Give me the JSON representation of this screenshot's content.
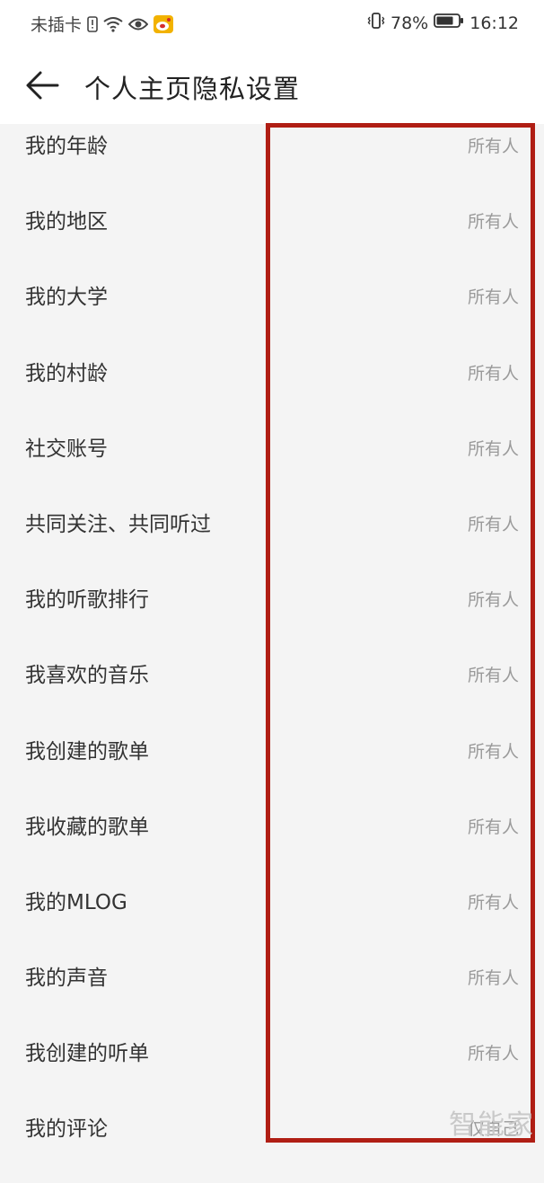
{
  "status_bar": {
    "carrier": "未插卡",
    "battery_percent": "78%",
    "time": "16:12",
    "icons": [
      "sim-alert-icon",
      "wifi-icon",
      "eye-icon",
      "weibo-icon",
      "vibrate-icon",
      "battery-icon"
    ]
  },
  "header": {
    "title": "个人主页隐私设置"
  },
  "settings": [
    {
      "label": "我的年龄",
      "value": "所有人"
    },
    {
      "label": "我的地区",
      "value": "所有人"
    },
    {
      "label": "我的大学",
      "value": "所有人"
    },
    {
      "label": "我的村龄",
      "value": "所有人"
    },
    {
      "label": "社交账号",
      "value": "所有人"
    },
    {
      "label": "共同关注、共同听过",
      "value": "所有人"
    },
    {
      "label": "我的听歌排行",
      "value": "所有人"
    },
    {
      "label": "我喜欢的音乐",
      "value": "所有人"
    },
    {
      "label": "我创建的歌单",
      "value": "所有人"
    },
    {
      "label": "我收藏的歌单",
      "value": "所有人"
    },
    {
      "label": "我的MLOG",
      "value": "所有人"
    },
    {
      "label": "我的声音",
      "value": "所有人"
    },
    {
      "label": "我创建的听单",
      "value": "所有人"
    },
    {
      "label": "我的评论",
      "value": "仅自己"
    }
  ],
  "watermark": "智能家",
  "colors": {
    "highlight_border": "#b01e14",
    "background": "#f4f4f4",
    "value_text": "#9a9a9a"
  }
}
